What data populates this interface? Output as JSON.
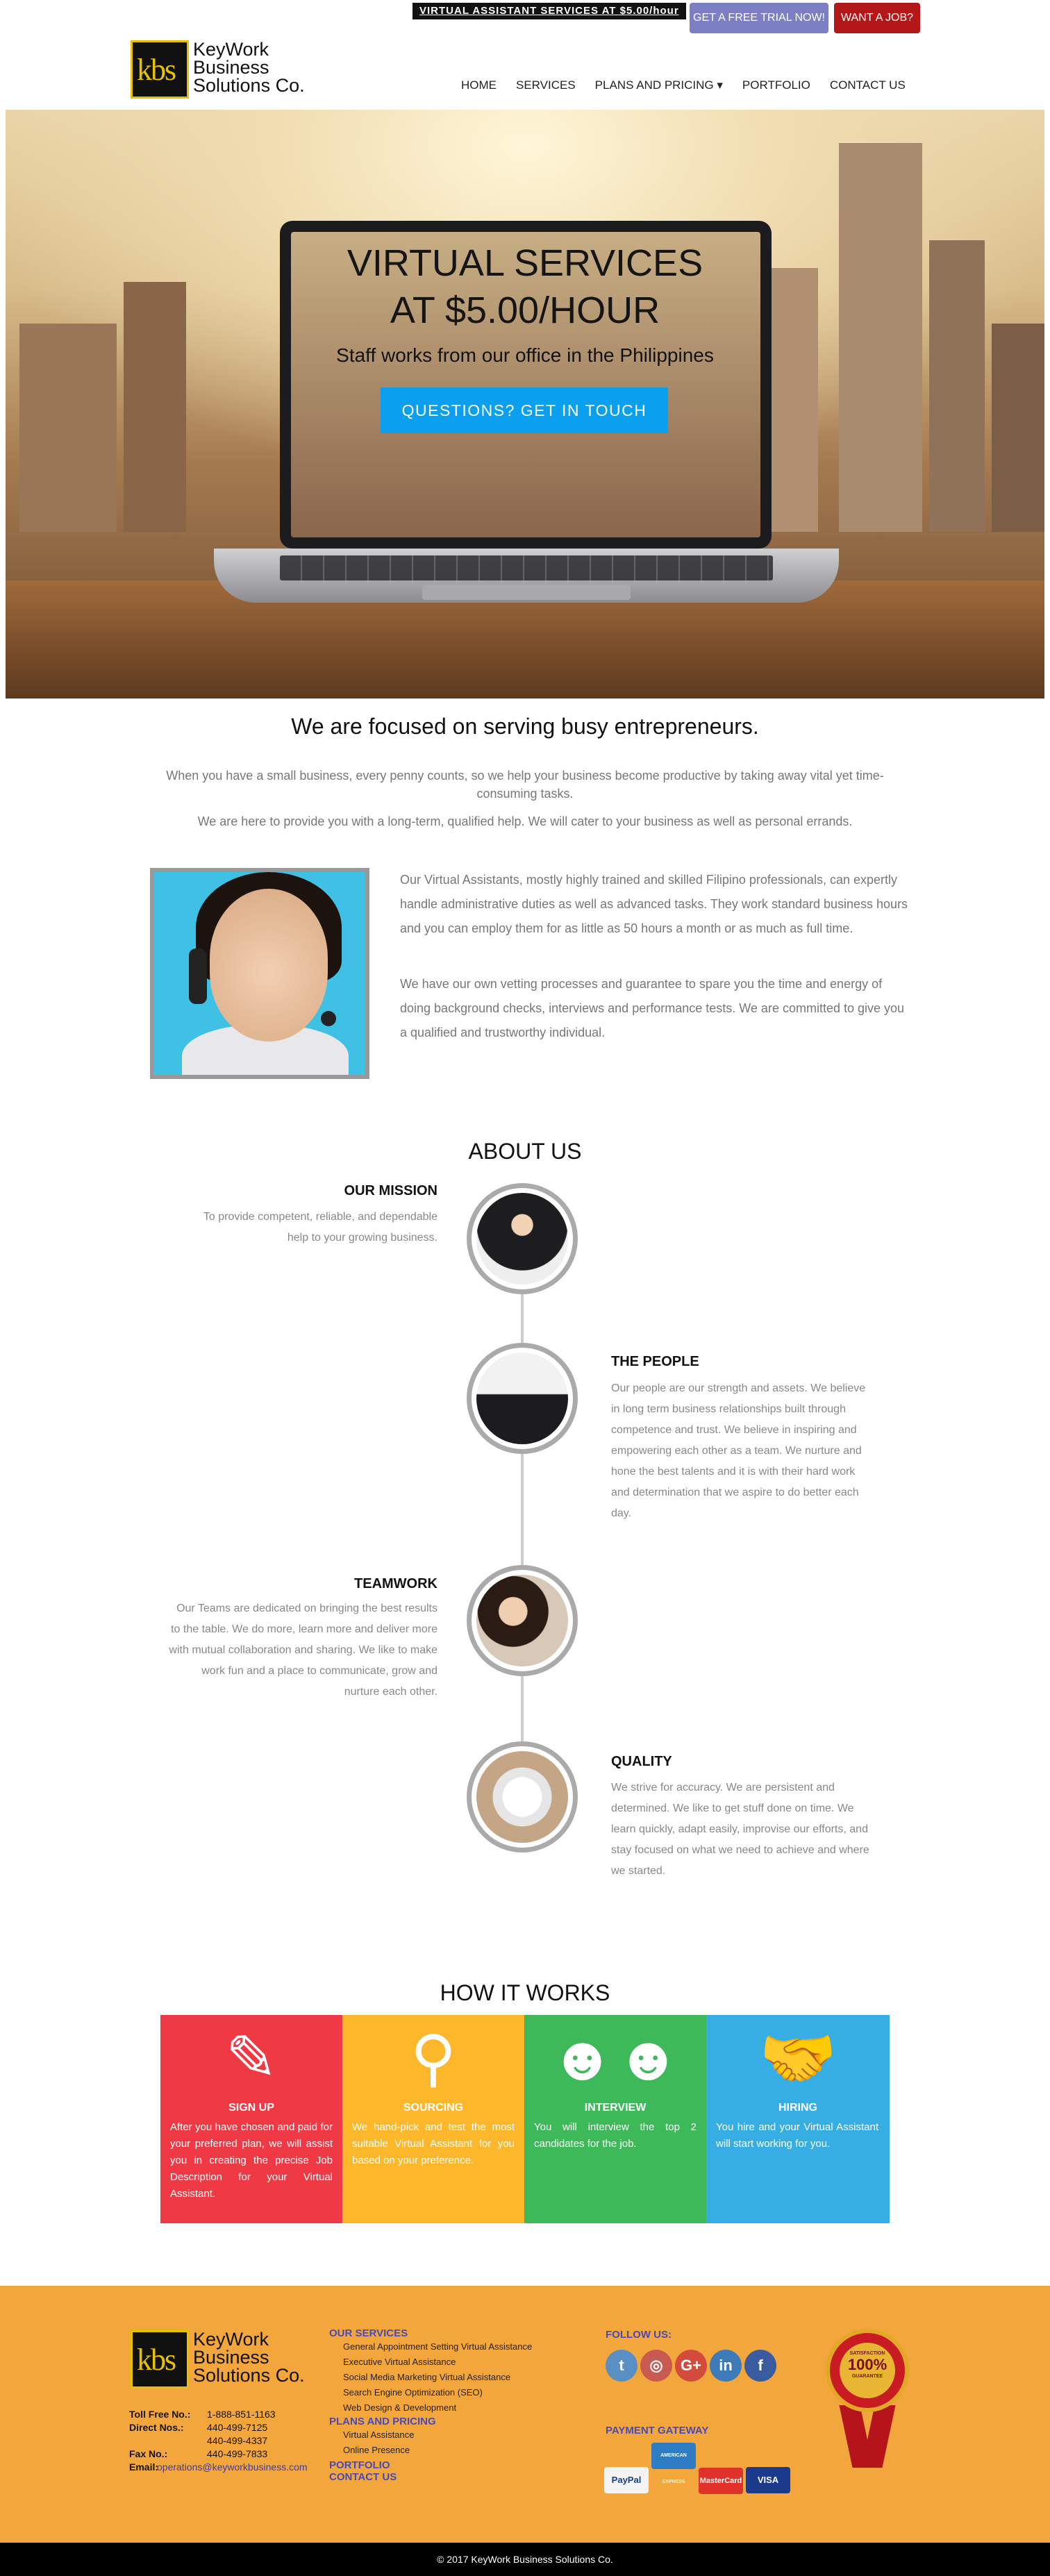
{
  "topbar": {
    "promo": "VIRTUAL ASSISTANT SERVICES AT $5.00/hour",
    "trial": "GET A FREE TRIAL NOW!",
    "job": "WANT A JOB?"
  },
  "logo": {
    "mark": "kbs",
    "line1": "KeyWork",
    "line2": "Business",
    "line3": "Solutions Co."
  },
  "nav": [
    "HOME",
    "SERVICES",
    "PLANS AND PRICING ▾",
    "PORTFOLIO",
    "CONTACT US"
  ],
  "hero": {
    "title1": "VIRTUAL SERVICES",
    "title2": "AT $5.00/HOUR",
    "sub": "Staff works from our office in the Philippines",
    "cta": "QUESTIONS? GET IN TOUCH"
  },
  "intro": {
    "heading": "We are focused on serving busy entrepreneurs.",
    "p1": "When you have a small business, every penny counts, so we help your business become productive by taking away vital yet time-consuming tasks.",
    "p2": "We are here to provide you with a long-term, qualified help. We will cater to your business as well as personal errands.",
    "p3": "Our Virtual Assistants, mostly highly trained and skilled Filipino professionals, can expertly handle administrative duties as well as advanced tasks. They work standard business hours and you can employ them for as little as 50 hours a month or as much as full time.",
    "p4": "We have our own vetting processes and guarantee to spare you the time and energy of doing background checks, interviews and performance tests. We are committed to give you a qualified and trustworthy individual."
  },
  "about": {
    "heading": "ABOUT US",
    "mission": {
      "title": "OUR MISSION",
      "text": "To provide competent, reliable, and dependable help to your growing business."
    },
    "people": {
      "title": "THE PEOPLE",
      "text": "Our people are our strength and assets. We believe in long term business relationships built through competence and trust. We believe in inspiring and empowering each other as a team. We nurture and hone the best talents and it is with their hard work and determination that we aspire to do better each day."
    },
    "teamwork": {
      "title": "TEAMWORK",
      "text": "Our Teams are dedicated on bringing the best results to the table. We do more, learn more and deliver more with mutual collaboration and sharing. We like to make work fun and a place to communicate, grow and nurture each other."
    },
    "quality": {
      "title": "QUALITY",
      "text": "We strive for accuracy. We are persistent and determined. We like to get stuff done on time. We learn quickly, adapt easily, improvise our efforts, and stay focused on what we need to achieve and where we started."
    }
  },
  "how": {
    "heading": "HOW IT WORKS",
    "cards": [
      {
        "title": "SIGN UP",
        "text": "After you have chosen and paid for your preferred plan, we will assist you in creating the precise Job Description for your Virtual Assistant.",
        "color": "#ef3a45",
        "icon": "edit-icon"
      },
      {
        "title": "SOURCING",
        "text": "We hand-pick and test the most suitable Virtual Assistant for you based on your preference.",
        "color": "#fcb72b",
        "icon": "search-person-icon"
      },
      {
        "title": "INTERVIEW",
        "text": "You will interview the top 2 candidates for the job.",
        "color": "#3eb95a",
        "icon": "chat-people-icon"
      },
      {
        "title": "HIRING",
        "text": "You hire and your Virtual Assistant will start working for you.",
        "color": "#36aee3",
        "icon": "handshake-icon"
      }
    ]
  },
  "footer": {
    "contacts": [
      {
        "label": "Toll Free No.:",
        "value": "1-888-851-1163"
      },
      {
        "label": "Direct Nos.:",
        "value": "440-499-7125"
      },
      {
        "label": "",
        "value": "440-499-4337"
      },
      {
        "label": "Fax No.:",
        "value": "440-499-7833"
      },
      {
        "label": "Email:",
        "value": "operations@keyworkbusiness.com"
      }
    ],
    "services_head": "OUR SERVICES",
    "services": [
      "General Appointment Setting Virtual Assistance",
      "Executive Virtual Assistance",
      "Social Media Marketing Virtual Assistance",
      "Search Engine Optimization (SEO)",
      "Web Design & Development"
    ],
    "plans_head": "PLANS AND PRICING",
    "plans": [
      "Virtual Assistance",
      "Online Presence"
    ],
    "portfolio": "PORTFOLIO",
    "contact": "CONTACT US",
    "follow": "FOLLOW US:",
    "payment": "PAYMENT GATEWAY",
    "pay": [
      "PayPal",
      "AMERICAN EXPRESS",
      "MasterCard",
      "VISA"
    ],
    "badge1": "SATISFACTION",
    "badge2": "100%",
    "badge3": "GUARANTEE",
    "copyright": "© 2017 KeyWork Business Solutions Co."
  }
}
